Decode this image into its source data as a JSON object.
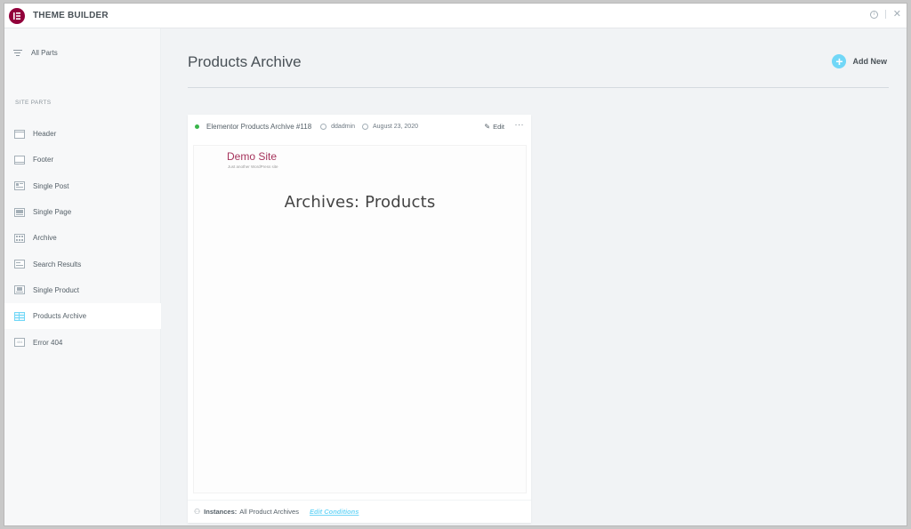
{
  "app": {
    "title": "THEME BUILDER",
    "logo_color": "#92003b",
    "accent_color": "#71d7f7"
  },
  "topbar": {
    "info_icon": "info-circle-icon",
    "close_icon": "close-icon"
  },
  "sidebar": {
    "all_parts_label": "All Parts",
    "section_label": "SITE PARTS",
    "items": [
      {
        "label": "Header",
        "icon": "header-icon",
        "active": false
      },
      {
        "label": "Footer",
        "icon": "footer-icon",
        "active": false
      },
      {
        "label": "Single Post",
        "icon": "single-post-icon",
        "active": false
      },
      {
        "label": "Single Page",
        "icon": "single-page-icon",
        "active": false
      },
      {
        "label": "Archive",
        "icon": "archive-icon",
        "active": false
      },
      {
        "label": "Search Results",
        "icon": "search-results-icon",
        "active": false
      },
      {
        "label": "Single Product",
        "icon": "single-product-icon",
        "active": false
      },
      {
        "label": "Products Archive",
        "icon": "products-archive-icon",
        "active": true
      },
      {
        "label": "Error 404",
        "icon": "error-404-icon",
        "active": false
      }
    ]
  },
  "main": {
    "page_title": "Products Archive",
    "add_new_label": "Add New"
  },
  "card": {
    "title": "Elementor Products Archive #118",
    "author": "ddadmin",
    "date": "August 23, 2020",
    "edit_label": "Edit",
    "more_label": "···",
    "status_color": "#39b54a",
    "preview": {
      "site_name": "Demo Site",
      "tagline": "Just another WordPress site",
      "heading": "Archives: Products"
    },
    "footer": {
      "instances_label": "Instances:",
      "instances_value": "All Product Archives",
      "edit_conditions_label": "Edit Conditions"
    }
  }
}
